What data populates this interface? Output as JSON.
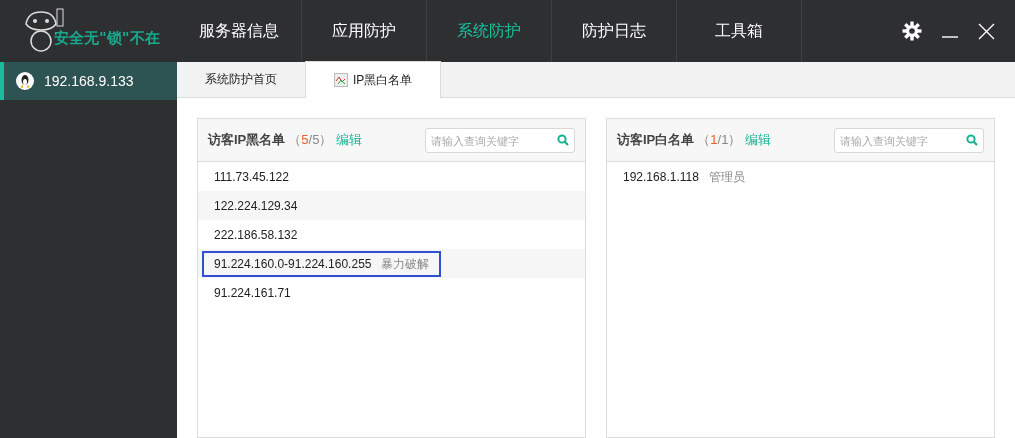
{
  "logo": {
    "slogan": "安全无\"锁\"不在"
  },
  "nav": [
    {
      "label": "服务器信息",
      "selected": false
    },
    {
      "label": "应用防护",
      "selected": false
    },
    {
      "label": "系统防护",
      "selected": true
    },
    {
      "label": "防护日志",
      "selected": false
    },
    {
      "label": "工具箱",
      "selected": false
    }
  ],
  "sidebar": {
    "items": [
      {
        "label": "192.168.9.133",
        "selected": true
      }
    ]
  },
  "tabs": [
    {
      "label": "系统防护首页",
      "selected": false,
      "icon": false
    },
    {
      "label": "IP黑白名单",
      "selected": true,
      "icon": true
    }
  ],
  "panels": [
    {
      "title": "访客IP黑名单",
      "open": "（",
      "count": "5",
      "sep": "/",
      "total": "5",
      "close": "）",
      "edit": "编辑",
      "search": {
        "placeholder": "请输入查询关键字"
      },
      "rows": [
        {
          "ip": "111.73.45.122",
          "selected": false
        },
        {
          "ip": "122.224.129.34",
          "selected": false
        },
        {
          "ip": "222.186.58.132",
          "selected": false
        },
        {
          "ip": "91.224.160.0-91.224.160.255",
          "note": "暴力破解",
          "selected": true
        },
        {
          "ip": "91.224.161.71",
          "selected": false
        }
      ]
    },
    {
      "title": "访客IP白名单",
      "open": "（",
      "count": "1",
      "sep": "/",
      "total": "1",
      "close": "）",
      "edit": "编辑",
      "search": {
        "placeholder": "请输入查询关键字"
      },
      "rows": [
        {
          "ip": "192.168.1.118",
          "note": "管理员",
          "selected": false
        }
      ]
    }
  ]
}
